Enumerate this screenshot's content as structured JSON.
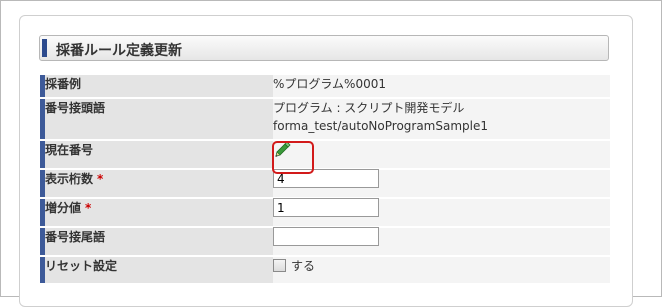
{
  "page": {
    "title": "採番ルール定義更新"
  },
  "form": {
    "example": {
      "label": "採番例",
      "value": "%プログラム%0001"
    },
    "prefix": {
      "label": "番号接頭語",
      "value_line1": "プログラム : スクリプト開発モデル",
      "value_line2": "forma_test/autoNoProgramSample1"
    },
    "current": {
      "label": "現在番号",
      "icon": "pencil-edit-icon"
    },
    "digits": {
      "label": "表示桁数",
      "required_mark": "*",
      "value": "4"
    },
    "increment": {
      "label": "増分値",
      "required_mark": "*",
      "value": "1"
    },
    "suffix": {
      "label": "番号接尾語",
      "value": ""
    },
    "reset": {
      "label": "リセット設定",
      "checkbox_label": "する",
      "checked": false
    }
  },
  "colors": {
    "accent": "#3d5a99",
    "highlight": "#d21a1a",
    "required": "#cc0000",
    "pencil": "#2e8b2e"
  }
}
